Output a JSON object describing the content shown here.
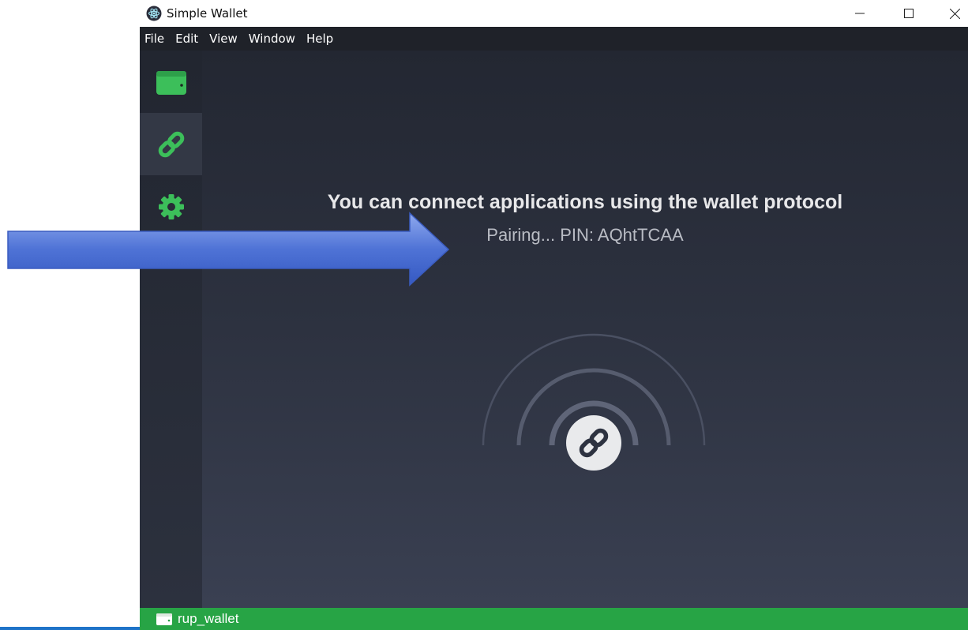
{
  "window": {
    "title": "Simple Wallet",
    "controls": {
      "minimize": "minimize",
      "maximize": "maximize",
      "close": "close"
    }
  },
  "menu": [
    "File",
    "Edit",
    "View",
    "Window",
    "Help"
  ],
  "sidebar": {
    "items": [
      {
        "name": "wallet",
        "icon": "wallet-icon",
        "active": false
      },
      {
        "name": "connect",
        "icon": "link-icon",
        "active": true
      },
      {
        "name": "settings",
        "icon": "gear-icon",
        "active": false
      }
    ]
  },
  "main": {
    "title": "You can connect applications using the wallet protocol",
    "status": "Pairing... PIN: AQhtTCAA"
  },
  "statusbar": {
    "wallet_name": "rup_wallet"
  },
  "colors": {
    "accent": "#3cbf5a",
    "statusbar": "#27a445",
    "annotation_arrow": "#4a6fd4"
  }
}
